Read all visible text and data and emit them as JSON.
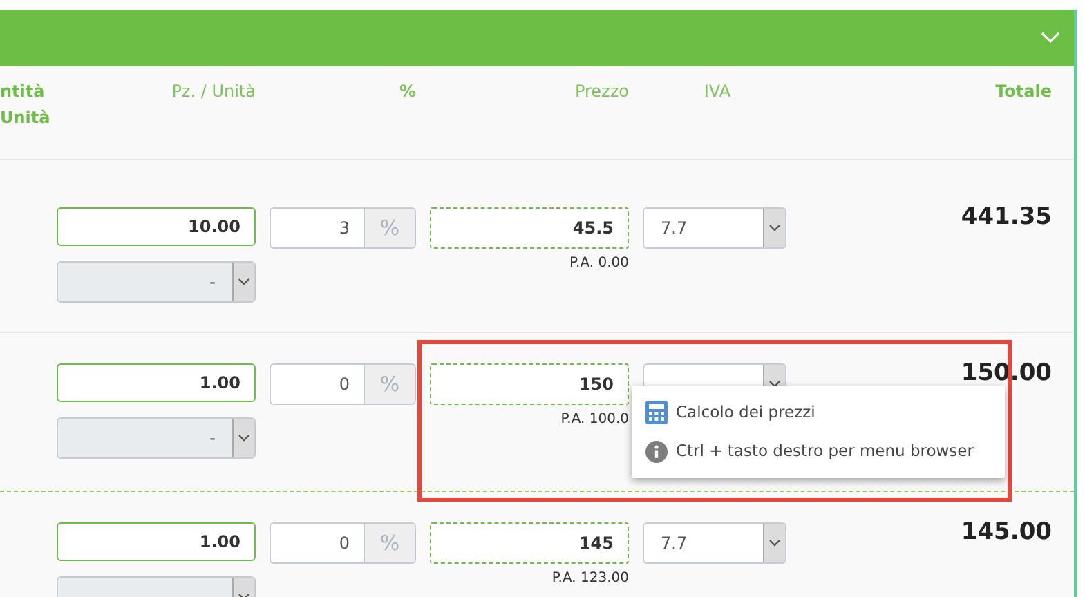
{
  "columns": {
    "quantity": [
      "ntità",
      "Unità"
    ],
    "pieces": "Pz. / Unità",
    "discount": "%",
    "price": "Prezzo",
    "vat": "IVA",
    "total": "Totale"
  },
  "rows": [
    {
      "quantity": "10.00",
      "unit": "-",
      "discount": "3",
      "discount_unit": "%",
      "price": "45.5",
      "purchase_price": "P.A. 0.00",
      "vat": "7.7",
      "total": "441.35"
    },
    {
      "quantity": "1.00",
      "unit": "-",
      "discount": "0",
      "discount_unit": "%",
      "price": "150",
      "purchase_price": "P.A. 100.0",
      "total": "150.00"
    },
    {
      "quantity": "1.00",
      "discount": "0",
      "discount_unit": "%",
      "price": "145",
      "purchase_price": "P.A. 123.00",
      "vat": "7.7",
      "total": "145.00"
    }
  ],
  "context_menu": {
    "items": [
      {
        "kind": "calculator",
        "label": "Calcolo dei prezzi"
      },
      {
        "kind": "info",
        "label": "Ctrl + tasto destro per menu browser"
      }
    ]
  }
}
